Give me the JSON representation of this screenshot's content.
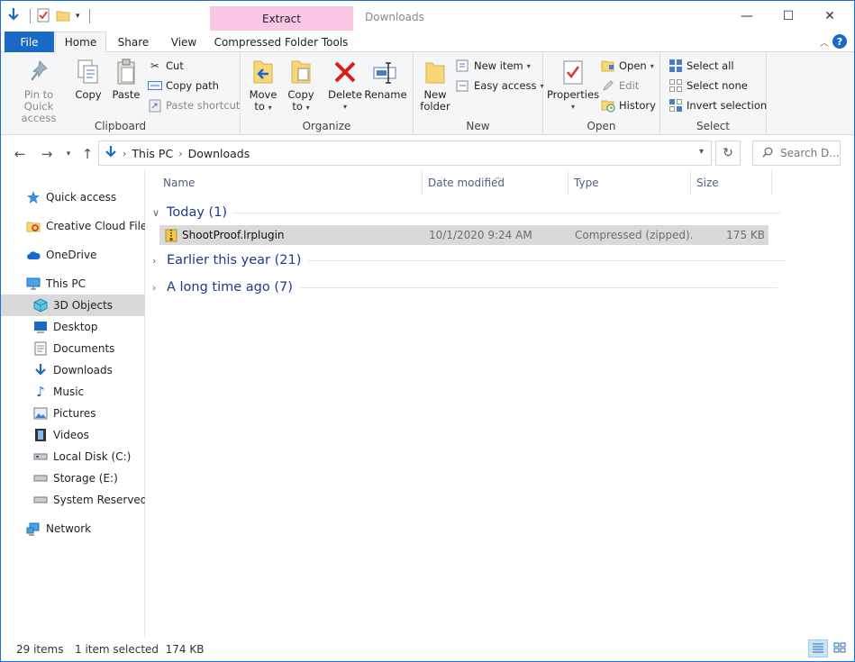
{
  "window": {
    "title": "Downloads",
    "contextual_header": "Extract",
    "minimize_glyph": "—",
    "maximize_glyph": "☐",
    "close_glyph": "✕"
  },
  "tabs": {
    "file": "File",
    "home": "Home",
    "share": "Share",
    "view": "View",
    "compressed_folder_tools": "Compressed Folder Tools"
  },
  "ribbon": {
    "clipboard": {
      "label": "Clipboard",
      "pin_line1": "Pin to Quick",
      "pin_line2": "access",
      "copy": "Copy",
      "paste": "Paste",
      "cut": "Cut",
      "copy_path": "Copy path",
      "paste_shortcut": "Paste shortcut"
    },
    "organize": {
      "label": "Organize",
      "move_line1": "Move",
      "move_line2": "to",
      "copy_line1": "Copy",
      "copy_line2": "to",
      "delete": "Delete",
      "rename": "Rename"
    },
    "new": {
      "label": "New",
      "new_folder_line1": "New",
      "new_folder_line2": "folder",
      "new_item": "New item",
      "easy_access": "Easy access"
    },
    "open": {
      "label": "Open",
      "properties": "Properties",
      "open": "Open",
      "edit": "Edit",
      "history": "History"
    },
    "select": {
      "label": "Select",
      "select_all": "Select all",
      "select_none": "Select none",
      "invert_selection": "Invert selection"
    }
  },
  "address": {
    "path": [
      "This PC",
      "Downloads"
    ],
    "search_placeholder": "Search D..."
  },
  "navpane": {
    "items": [
      {
        "label": "Quick access",
        "icon": "star-icon"
      },
      {
        "label": "Creative Cloud Files",
        "icon": "creative-cloud-icon"
      },
      {
        "label": "OneDrive",
        "icon": "cloud-icon"
      },
      {
        "label": "This PC",
        "icon": "computer-icon"
      },
      {
        "label": "3D Objects",
        "icon": "cube-icon"
      },
      {
        "label": "Desktop",
        "icon": "desktop-icon"
      },
      {
        "label": "Documents",
        "icon": "document-icon"
      },
      {
        "label": "Downloads",
        "icon": "download-arrow-icon"
      },
      {
        "label": "Music",
        "icon": "music-note-icon"
      },
      {
        "label": "Pictures",
        "icon": "picture-icon"
      },
      {
        "label": "Videos",
        "icon": "film-icon"
      },
      {
        "label": "Local Disk (C:)",
        "icon": "drive-icon"
      },
      {
        "label": "Storage (E:)",
        "icon": "drive-icon"
      },
      {
        "label": "System Reserved (F:",
        "icon": "drive-icon"
      },
      {
        "label": "Network",
        "icon": "network-icon"
      }
    ],
    "selected": "3D Objects"
  },
  "columns": [
    "Name",
    "Date modified",
    "Type",
    "Size"
  ],
  "groups": [
    {
      "label": "Today (1)",
      "expanded": true
    },
    {
      "label": "Earlier this year (21)",
      "expanded": false
    },
    {
      "label": "A long time ago (7)",
      "expanded": false
    }
  ],
  "files": [
    {
      "name": "ShootProof.lrplugin",
      "date": "10/1/2020 9:24 AM",
      "type": "Compressed (zipped)...",
      "size": "175 KB",
      "selected": true
    }
  ],
  "status": {
    "items": "29 items",
    "selected": "1 item selected  174 KB"
  },
  "colors": {
    "accent": "#1a69c4",
    "contextual": "#f9c7e5",
    "selection": "#d9d9d9",
    "group_text": "#1e3a8a"
  }
}
